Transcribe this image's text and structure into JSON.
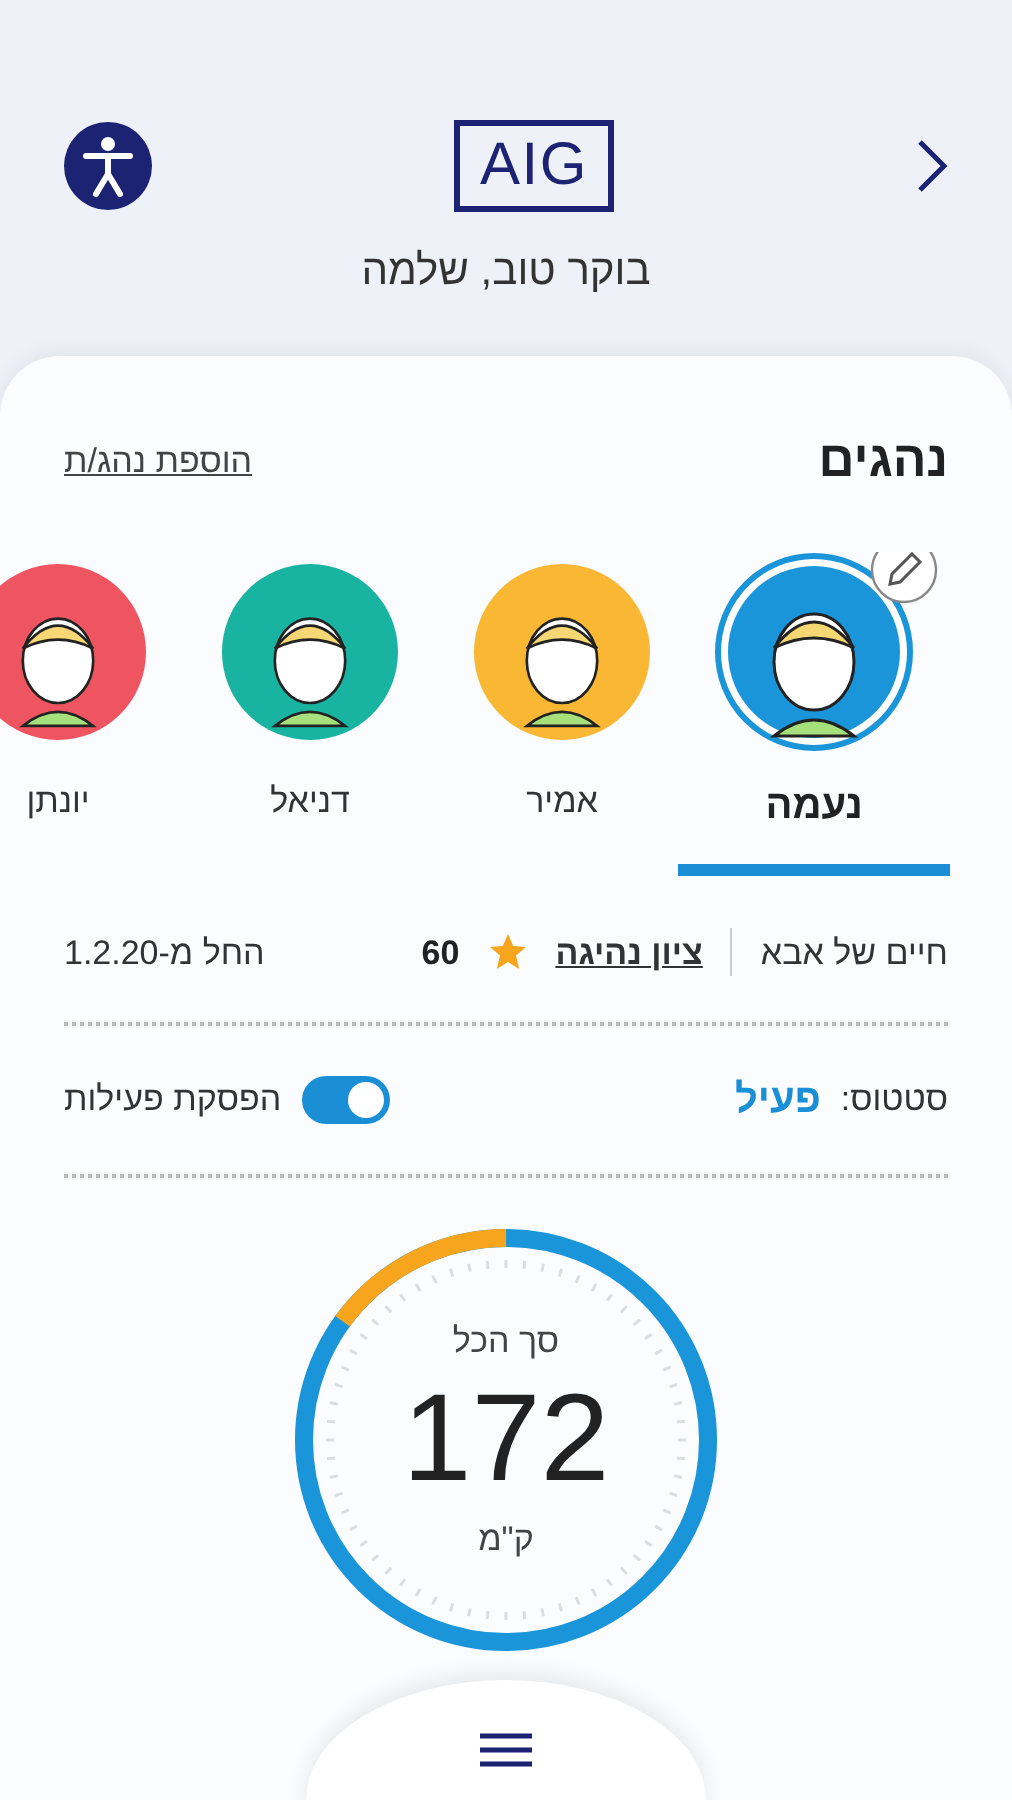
{
  "header": {
    "logo": "AIG",
    "greeting": "בוקר טוב, שלמה"
  },
  "drivers_section": {
    "title": "נהגים",
    "add_link": "הוספת נהג/ת"
  },
  "drivers": [
    {
      "name": "נעמה",
      "selected": true,
      "color": "#1b95d9"
    },
    {
      "name": "אמיר",
      "selected": false,
      "color": "#f9b733"
    },
    {
      "name": "דניאל",
      "selected": false,
      "color": "#19b3a1"
    },
    {
      "name": "יונתן",
      "selected": false,
      "color": "#ef5560"
    }
  ],
  "policy": {
    "name": "חיים של אבא",
    "score_label": "ציון נהיגה",
    "score": "60",
    "start": "החל מ-1.2.20"
  },
  "status": {
    "label": "סטטוס:",
    "value": "פעיל",
    "toggle_label": "הפסקת פעילות",
    "on": true
  },
  "gauge": {
    "title": "סך הכל",
    "value": "172",
    "unit": "ק\"מ",
    "level": 0.15
  }
}
